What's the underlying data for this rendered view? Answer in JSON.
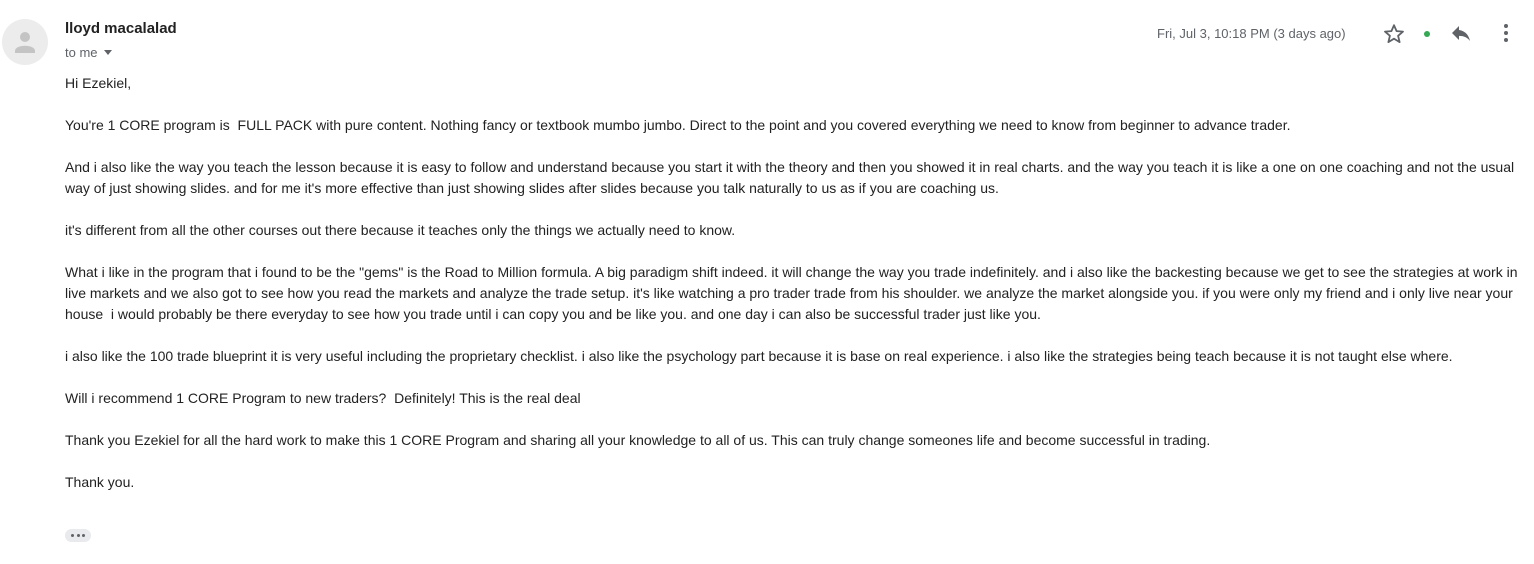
{
  "message": {
    "sender_name": "lloyd macalalad",
    "recipient_label": "to me",
    "timestamp": "Fri, Jul 3, 10:18 PM (3 days ago)",
    "status_color": "#34a853"
  },
  "actions": {
    "star_icon": "star-outline",
    "reply_icon": "reply-arrow",
    "more_icon": "vertical-ellipsis",
    "trim_icon": "horizontal-ellipsis"
  },
  "body": {
    "greeting": "Hi Ezekiel,",
    "paragraphs": [
      "You're 1 CORE program is  FULL PACK with pure content. Nothing fancy or textbook mumbo jumbo. Direct to the point and you covered everything we need to know from beginner to advance trader.",
      "And i also like the way you teach the lesson because it is easy to follow and understand because you start it with the theory and then you showed it in real charts. and the way you teach it is like a one on one coaching and not the usual way of just showing slides. and for me it's more effective than just showing slides after slides because you talk naturally to us as if you are coaching us.",
      "it's different from all the other courses out there because it teaches only the things we actually need to know.",
      "What i like in the program that i found to be the \"gems\" is the Road to Million formula. A big paradigm shift indeed. it will change the way you trade indefinitely. and i also like the backesting because we get to see the strategies at work in live markets and we also got to see how you read the markets and analyze the trade setup. it's like watching a pro trader trade from his shoulder. we analyze the market alongside you. if you were only my friend and i only live near your house  i would probably be there everyday to see how you trade until i can copy you and be like you. and one day i can also be successful trader just like you.",
      "i also like the 100 trade blueprint it is very useful including the proprietary checklist. i also like the psychology part because it is base on real experience. i also like the strategies being teach because it is not taught else where.",
      "Will i recommend 1 CORE Program to new traders?  Definitely! This is the real deal",
      "Thank you Ezekiel for all the hard work to make this 1 CORE Program and sharing all your knowledge to all of us. This can truly change someones life and become successful in trading.",
      "Thank you."
    ]
  }
}
